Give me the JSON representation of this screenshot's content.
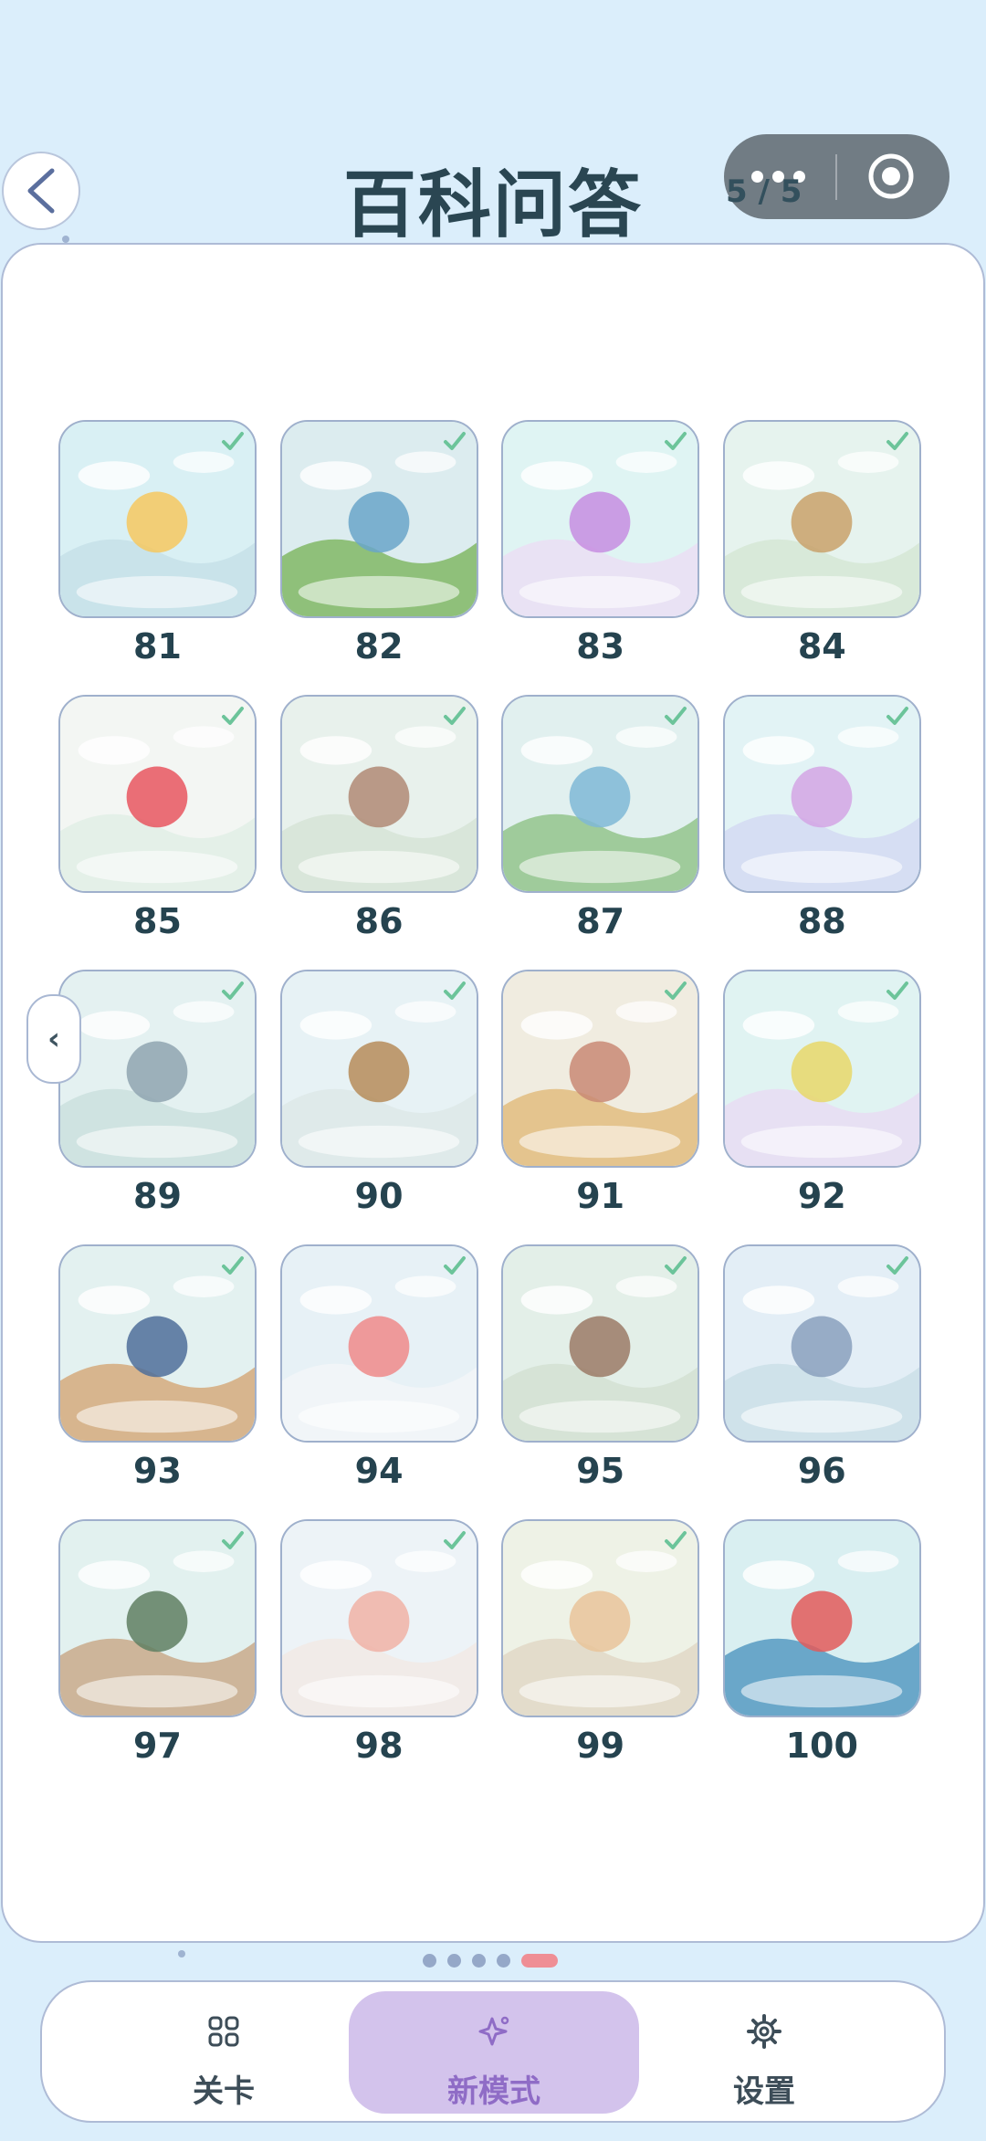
{
  "header": {
    "title": "百科问答",
    "page_indicator": "5 / 5",
    "back_icon": "chevron-left-icon",
    "menu_icon": "more-dots-icon",
    "close_icon": "target-circle-icon"
  },
  "levels": [
    {
      "number": "81",
      "completed": true,
      "theme": "sun-factory-cloud"
    },
    {
      "number": "82",
      "completed": true,
      "theme": "rain-mountain-river"
    },
    {
      "number": "83",
      "completed": true,
      "theme": "chemistry-bottles"
    },
    {
      "number": "84",
      "completed": true,
      "theme": "easel-laurel"
    },
    {
      "number": "85",
      "completed": true,
      "theme": "fruits-food"
    },
    {
      "number": "86",
      "completed": true,
      "theme": "ancient-palace"
    },
    {
      "number": "87",
      "completed": true,
      "theme": "lake-islands"
    },
    {
      "number": "88",
      "completed": true,
      "theme": "physics-blocks"
    },
    {
      "number": "89",
      "completed": true,
      "theme": "moon-scroll-brush"
    },
    {
      "number": "90",
      "completed": true,
      "theme": "pocket-watch-dove"
    },
    {
      "number": "91",
      "completed": true,
      "theme": "desert-mountains"
    },
    {
      "number": "92",
      "completed": true,
      "theme": "chemistry-flasks"
    },
    {
      "number": "93",
      "completed": true,
      "theme": "books-quill"
    },
    {
      "number": "94",
      "completed": true,
      "theme": "blood-cells"
    },
    {
      "number": "95",
      "completed": true,
      "theme": "temple-courtyard"
    },
    {
      "number": "96",
      "completed": true,
      "theme": "seasons-window"
    },
    {
      "number": "97",
      "completed": true,
      "theme": "lamp-books"
    },
    {
      "number": "98",
      "completed": true,
      "theme": "human-body"
    },
    {
      "number": "99",
      "completed": true,
      "theme": "city-cloud"
    },
    {
      "number": "100",
      "completed": false,
      "theme": "earth-layers"
    }
  ],
  "pager": {
    "total": 5,
    "active_index": 4
  },
  "prev_arrow": "‹",
  "tabs": [
    {
      "label": "关卡",
      "icon": "grid-icon",
      "active": false
    },
    {
      "label": "新模式",
      "icon": "sparkle-icon",
      "active": true
    },
    {
      "label": "设置",
      "icon": "gear-icon",
      "active": false
    }
  ],
  "colors": {
    "accent": "#8f6cc6",
    "active_tab_bg": "#d3c3ec",
    "pager_active": "#ef8e95",
    "check": "#6cc49a"
  }
}
